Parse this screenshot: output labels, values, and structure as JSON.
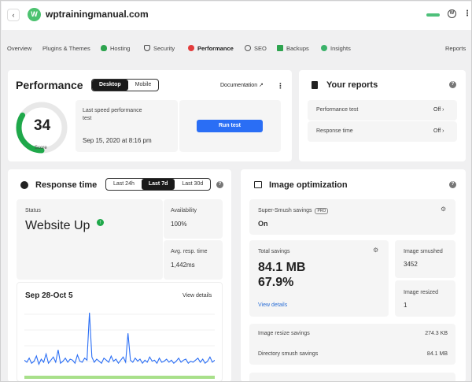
{
  "header": {
    "back_icon": "chevron-left-icon",
    "avatar_letter": "W",
    "site_name": "wptrainingmanual.com",
    "status_color": "#4ec07a",
    "wp_icon": "W",
    "menu_icon": "⋮"
  },
  "nav": {
    "items": [
      {
        "label": "Overview"
      },
      {
        "label": "Plugins & Themes"
      },
      {
        "label": "Hosting",
        "icon": "cloud-icon"
      },
      {
        "label": "Security",
        "icon": "shield-icon"
      },
      {
        "label": "Performance",
        "icon": "gauge-icon"
      },
      {
        "label": "SEO",
        "icon": "globe-icon"
      },
      {
        "label": "Backups",
        "icon": "backup-icon"
      },
      {
        "label": "Insights",
        "icon": "insights-icon"
      },
      {
        "label": "Reports"
      }
    ]
  },
  "performance": {
    "title": "Performance",
    "tabs": [
      "Desktop",
      "Mobile"
    ],
    "documentation_label": "Documentation",
    "score": "34",
    "score_fraction": 0.34,
    "score_label": "Score",
    "last_test_label": "Last speed performance test",
    "last_test_date": "Sep 15, 2020 at 8:16 pm",
    "run_test_label": "Run test"
  },
  "reports": {
    "title": "Your reports",
    "rows": [
      {
        "label": "Performance test",
        "status": "Off"
      },
      {
        "label": "Response time",
        "status": "Off"
      }
    ]
  },
  "response_time": {
    "title": "Response time",
    "ranges": [
      "Last 24h",
      "Last 7d",
      "Last 30d"
    ],
    "status_label": "Status",
    "status_value": "Website Up",
    "availability_label": "Availability",
    "availability_value": "100%",
    "avg_label": "Avg. resp. time",
    "avg_value": "1,442ms",
    "period": "Sep 28-Oct 5",
    "view_details": "View details"
  },
  "image_optimization": {
    "title": "Image optimization",
    "super_smush_label": "Super-Smush savings",
    "pro_badge": "PRO",
    "super_smush_value": "On",
    "total_savings_label": "Total savings",
    "total_savings_mb": "84.1 MB",
    "total_savings_pct": "67.9%",
    "view_details": "View details",
    "smushed_label": "Image smushed",
    "smushed_value": "3452",
    "resized_label": "Image resized",
    "resized_value": "1",
    "resize_savings_label": "Image resize savings",
    "resize_savings_value": "274.3 KB",
    "directory_label": "Directory smush savings",
    "directory_value": "84.1 MB"
  },
  "chart_data": {
    "type": "line",
    "title": "Sep 28-Oct 5",
    "xlabel": "",
    "ylabel": "",
    "series": [
      {
        "values": [
          12,
          10,
          14,
          9,
          11,
          16,
          8,
          13,
          10,
          18,
          9,
          12,
          15,
          10,
          22,
          9,
          11,
          14,
          10,
          13,
          12,
          9,
          17,
          11,
          10,
          14,
          12,
          58,
          15,
          10,
          13,
          11,
          9,
          14,
          12,
          10,
          16,
          11,
          13,
          9,
          12,
          15,
          10,
          38,
          12,
          10,
          14,
          11,
          13,
          9,
          12,
          10,
          15,
          11,
          12,
          9,
          14,
          10,
          11,
          13,
          10,
          12,
          9,
          11,
          14,
          10,
          12,
          13,
          9,
          11,
          10,
          12,
          14,
          10,
          13,
          9,
          11,
          15,
          10,
          12
        ]
      }
    ]
  }
}
